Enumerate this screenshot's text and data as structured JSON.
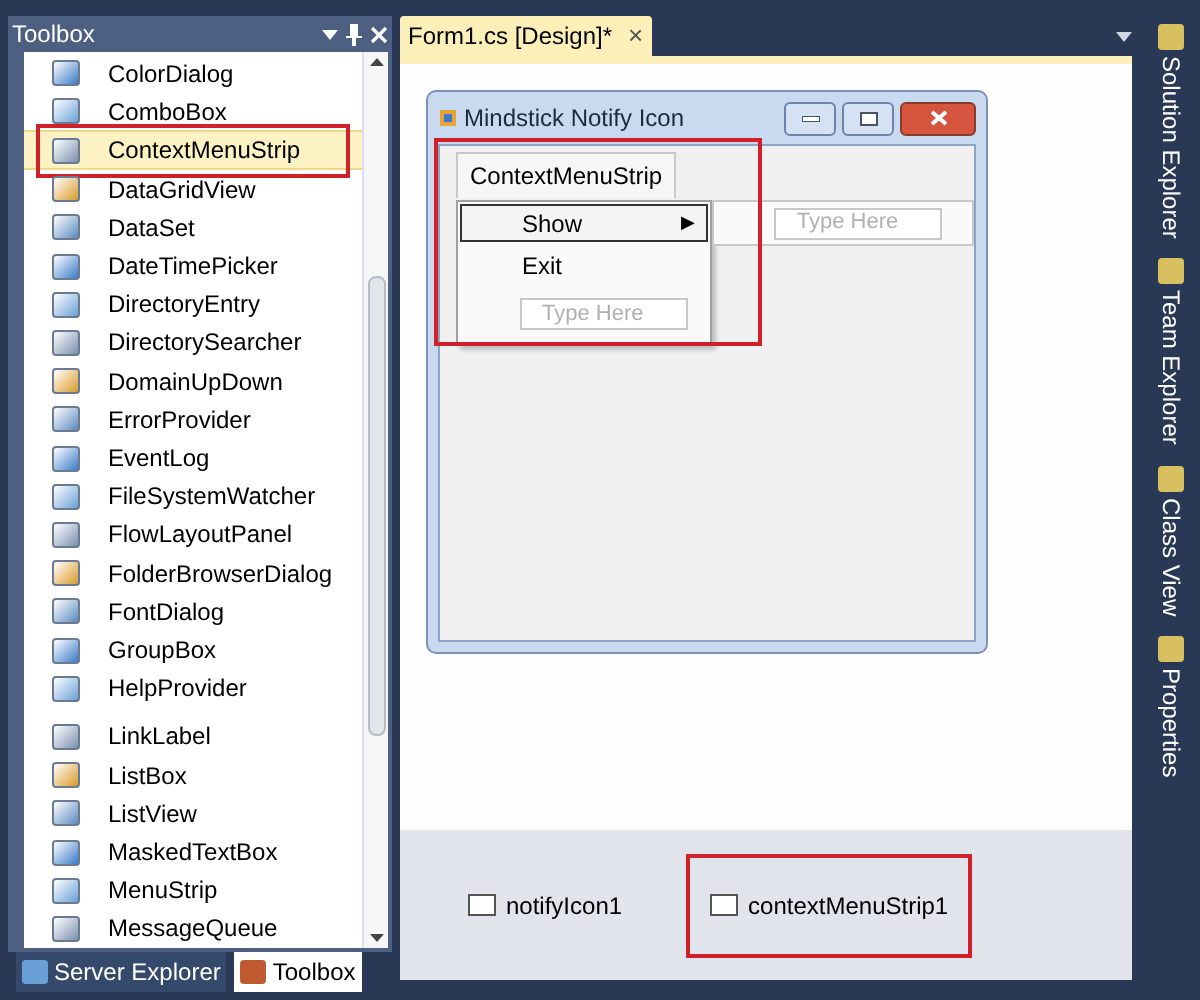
{
  "toolbox": {
    "title": "Toolbox",
    "items": [
      {
        "label": "ColorDialog",
        "selected": false
      },
      {
        "label": "ComboBox",
        "selected": false
      },
      {
        "label": "ContextMenuStrip",
        "selected": true,
        "highlighted": true
      },
      {
        "label": "DataGridView",
        "selected": false
      },
      {
        "label": "DataSet",
        "selected": false
      },
      {
        "label": "DateTimePicker",
        "selected": false
      },
      {
        "label": "DirectoryEntry",
        "selected": false
      },
      {
        "label": "DirectorySearcher",
        "selected": false
      },
      {
        "label": "DomainUpDown",
        "selected": false
      },
      {
        "label": "ErrorProvider",
        "selected": false
      },
      {
        "label": "EventLog",
        "selected": false
      },
      {
        "label": "FileSystemWatcher",
        "selected": false
      },
      {
        "label": "FlowLayoutPanel",
        "selected": false
      },
      {
        "label": "FolderBrowserDialog",
        "selected": false
      },
      {
        "label": "FontDialog",
        "selected": false
      },
      {
        "label": "GroupBox",
        "selected": false
      },
      {
        "label": "HelpProvider",
        "selected": false
      },
      {
        "label": "LinkLabel",
        "selected": false
      },
      {
        "label": "ListBox",
        "selected": false
      },
      {
        "label": "ListView",
        "selected": false
      },
      {
        "label": "MaskedTextBox",
        "selected": false
      },
      {
        "label": "MenuStrip",
        "selected": false
      },
      {
        "label": "MessageQueue",
        "selected": false
      }
    ],
    "bottom_tabs": [
      {
        "label": "Server Explorer",
        "selected": false
      },
      {
        "label": "Toolbox",
        "selected": true
      }
    ]
  },
  "document_tab": {
    "title": "Form1.cs [Design]*",
    "close": "×"
  },
  "form": {
    "title": "Mindstick Notify Icon",
    "highlighted": true,
    "menu_strip": {
      "label": "ContextMenuStrip"
    },
    "menu_items": [
      {
        "label": "Show",
        "selected": true,
        "submenu": "▶"
      },
      {
        "label": "Exit",
        "selected": false
      }
    ],
    "menu_placeholder": "Type Here",
    "submenu_placeholder": "Type Here"
  },
  "component_tray": [
    {
      "label": "notifyIcon1",
      "highlighted": false
    },
    {
      "label": "contextMenuStrip1",
      "highlighted": true
    }
  ],
  "side_tabs": [
    {
      "label": "Solution Explorer"
    },
    {
      "label": "Team Explorer"
    },
    {
      "label": "Class View"
    },
    {
      "label": "Properties"
    }
  ]
}
